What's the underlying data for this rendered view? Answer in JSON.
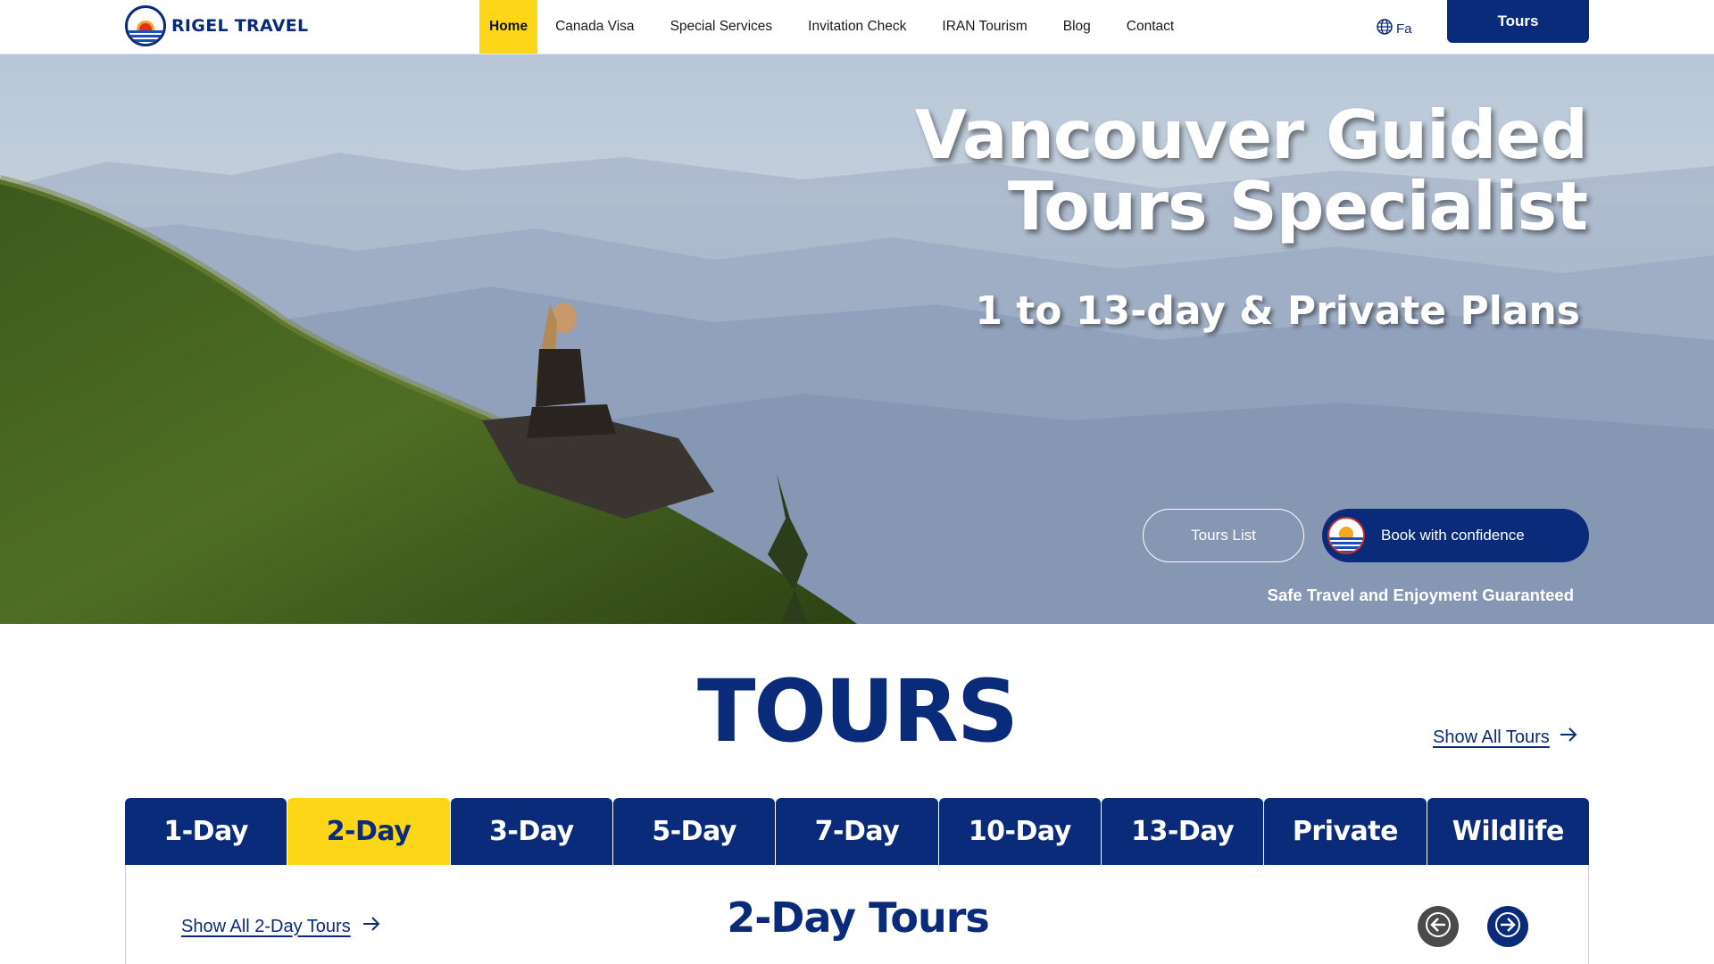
{
  "brand": {
    "name": "RIGEL TRAVEL"
  },
  "nav": {
    "items": [
      {
        "label": "Home",
        "active": true
      },
      {
        "label": "Canada Visa",
        "active": false
      },
      {
        "label": "Special Services",
        "active": false
      },
      {
        "label": "Invitation Check",
        "active": false
      },
      {
        "label": "IRAN Tourism",
        "active": false
      },
      {
        "label": "Blog",
        "active": false
      },
      {
        "label": "Contact",
        "active": false
      }
    ],
    "language_label": "Fa",
    "tours_button": "Tours"
  },
  "hero": {
    "title_line1": "Vancouver Guided",
    "title_line2": "Tours Specialist",
    "subtitle": "1 to 13-day & Private Plans",
    "tours_list_button": "Tours List",
    "book_button": "Book with confidence",
    "tagline": "Safe Travel and Enjoyment Guaranteed"
  },
  "tours": {
    "heading": "TOURS",
    "show_all": "Show All Tours",
    "tabs": [
      {
        "label": "1-Day",
        "active": false
      },
      {
        "label": "2-Day",
        "active": true
      },
      {
        "label": "3-Day",
        "active": false
      },
      {
        "label": "5-Day",
        "active": false
      },
      {
        "label": "7-Day",
        "active": false
      },
      {
        "label": "10-Day",
        "active": false
      },
      {
        "label": "13-Day",
        "active": false
      },
      {
        "label": "Private",
        "active": false
      },
      {
        "label": "Wildlife",
        "active": false
      }
    ],
    "panel": {
      "show_all_link": "Show All 2-Day Tours",
      "title": "2-Day Tours"
    }
  },
  "colors": {
    "brand_navy": "#0a2a7a",
    "accent_yellow": "#fdd618"
  },
  "icons": {
    "language": "globe-icon",
    "arrow_right": "arrow-right-icon",
    "prev": "arrow-left-circle-icon",
    "next": "arrow-right-circle-icon"
  }
}
